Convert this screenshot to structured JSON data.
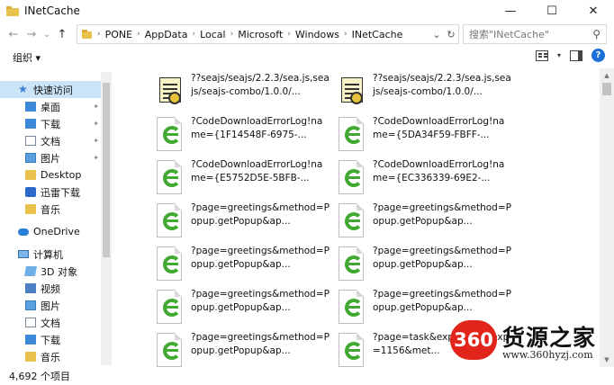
{
  "window": {
    "title": "INetCache",
    "minimize": "—",
    "maximize": "☐",
    "close": "✕"
  },
  "nav": {
    "back": "←",
    "forward": "→",
    "recent": "⌄",
    "up": "↑",
    "breadcrumbs": [
      "PONE",
      "AppData",
      "Local",
      "Microsoft",
      "Windows",
      "INetCache"
    ],
    "crumb_separator": "›",
    "dropdown": "⌄",
    "refresh": "↻",
    "search_placeholder": "搜索\"INetCache\"",
    "search_icon": "⚲"
  },
  "toolbar": {
    "organize": "组织 ▾",
    "view_caret": "▾",
    "help": "?"
  },
  "sidebar": {
    "items": [
      {
        "label": "快速访问",
        "icon": "star-icon",
        "pinned": false
      },
      {
        "label": "桌面",
        "icon": "desktop-icon",
        "pinned": true
      },
      {
        "label": "下载",
        "icon": "download-icon",
        "pinned": true
      },
      {
        "label": "文档",
        "icon": "document-icon",
        "pinned": true
      },
      {
        "label": "图片",
        "icon": "picture-icon",
        "pinned": true
      },
      {
        "label": "Desktop",
        "icon": "folder-icon",
        "pinned": false
      },
      {
        "label": "迅雷下载",
        "icon": "thunder-icon",
        "pinned": false
      },
      {
        "label": "音乐",
        "icon": "music-icon",
        "pinned": false
      },
      {
        "label": "OneDrive",
        "icon": "onedrive-icon",
        "pinned": false
      },
      {
        "label": "计算机",
        "icon": "computer-icon",
        "pinned": false
      },
      {
        "label": "3D 对象",
        "icon": "3d-objects-icon",
        "pinned": false
      },
      {
        "label": "视频",
        "icon": "video-icon",
        "pinned": false
      },
      {
        "label": "图片",
        "icon": "picture-icon",
        "pinned": false
      },
      {
        "label": "文档",
        "icon": "document-icon",
        "pinned": false
      },
      {
        "label": "下载",
        "icon": "download-icon",
        "pinned": false
      },
      {
        "label": "音乐",
        "icon": "music-icon",
        "pinned": false
      }
    ],
    "pin_glyph": "📌"
  },
  "files": [
    {
      "name": "??seajs/seajs/2.2.3/sea.js,seajs/seajs-combo/1.0.0/...",
      "icon": "js-script-icon"
    },
    {
      "name": "??seajs/seajs/2.2.3/sea.js,seajs/seajs-combo/1.0.0/...",
      "icon": "js-script-icon"
    },
    {
      "name": "?CodeDownloadErrorLog!name={1F14548F-6975-...",
      "icon": "ie-document-icon"
    },
    {
      "name": "?CodeDownloadErrorLog!name={5DA34F59-FBFF-...",
      "icon": "ie-document-icon"
    },
    {
      "name": "?CodeDownloadErrorLog!name={E5752D5E-5BFB-...",
      "icon": "ie-document-icon"
    },
    {
      "name": "?CodeDownloadErrorLog!name={EC336339-69E2-...",
      "icon": "ie-document-icon"
    },
    {
      "name": "?page=greetings&method=Popup.getPopup&ap...",
      "icon": "ie-document-icon"
    },
    {
      "name": "?page=greetings&method=Popup.getPopup&ap...",
      "icon": "ie-document-icon"
    },
    {
      "name": "?page=greetings&method=Popup.getPopup&ap...",
      "icon": "ie-document-icon"
    },
    {
      "name": "?page=greetings&method=Popup.getPopup&ap...",
      "icon": "ie-document-icon"
    },
    {
      "name": "?page=greetings&method=Popup.getPopup&ap...",
      "icon": "ie-document-icon"
    },
    {
      "name": "?page=greetings&method=Popup.getPopup&ap...",
      "icon": "ie-document-icon"
    },
    {
      "name": "?page=greetings&method=Popup.getPopup&ap...",
      "icon": "ie-document-icon"
    },
    {
      "name": "?page=task&exp=1...extexp=1156&met...",
      "icon": "ie-document-icon"
    }
  ],
  "status": {
    "item_count": "4,692 个项目"
  },
  "watermark": {
    "badge": "360",
    "title": "货源之家",
    "url": "www.360hyzj.com"
  },
  "colors": {
    "selection": "#cce4f7",
    "ie_green": "#41a832",
    "folder_yellow": "#e8c24a",
    "accent_blue": "#1a6fd8",
    "watermark_red": "#e1251b"
  }
}
